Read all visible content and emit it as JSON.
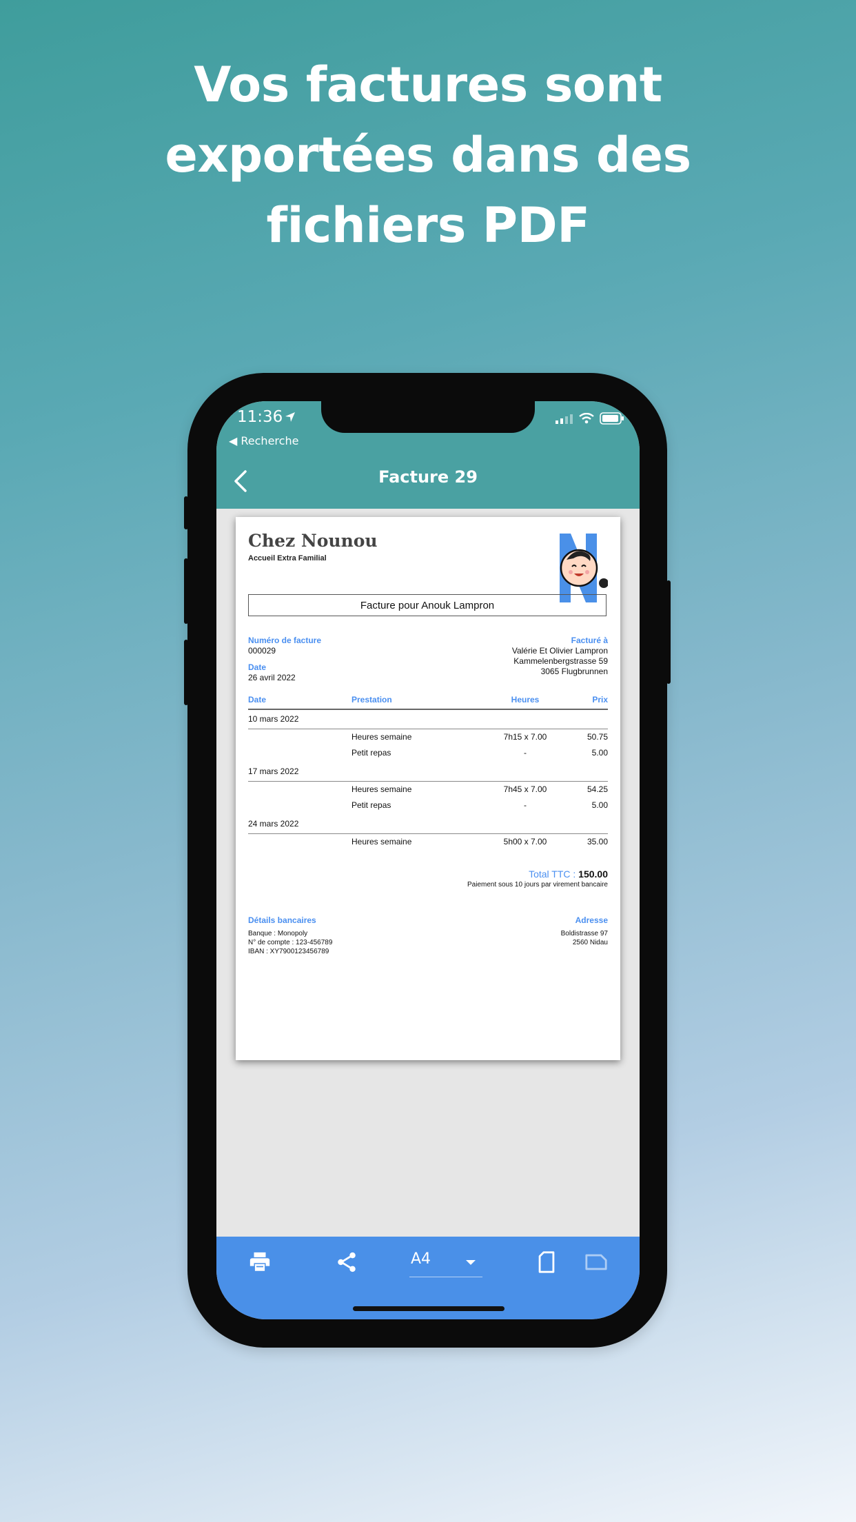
{
  "headline": [
    "Vos factures sont",
    "exportées dans des",
    "fichiers PDF"
  ],
  "status_bar": {
    "time": "11:36",
    "back_app": "◀ Recherche"
  },
  "nav": {
    "title": "Facture 29"
  },
  "invoice": {
    "brand": "Chez Nounou",
    "brand_sub": "Accueil Extra Familial",
    "invoice_for": "Facture pour Anouk Lampron",
    "number_label": "Numéro de facture",
    "number": "000029",
    "date_label": "Date",
    "date": "26 avril 2022",
    "billed_label": "Facturé à",
    "billed_lines": [
      "Valérie Et Olivier Lampron",
      "Kammelenbergstrasse 59",
      "3065 Flugbrunnen"
    ],
    "columns": [
      "Date",
      "Prestation",
      "Heures",
      "Prix"
    ],
    "groups": [
      {
        "date": "10 mars 2022",
        "rows": [
          {
            "service": "Heures semaine",
            "hours": "7h15 x 7.00",
            "price": "50.75"
          },
          {
            "service": "Petit repas",
            "hours": "-",
            "price": "5.00"
          }
        ]
      },
      {
        "date": "17 mars 2022",
        "rows": [
          {
            "service": "Heures semaine",
            "hours": "7h45 x 7.00",
            "price": "54.25"
          },
          {
            "service": "Petit repas",
            "hours": "-",
            "price": "5.00"
          }
        ]
      },
      {
        "date": "24 mars 2022",
        "rows": [
          {
            "service": "Heures semaine",
            "hours": "5h00 x 7.00",
            "price": "35.00"
          }
        ]
      }
    ],
    "total_label": "Total TTC :",
    "total_value": "150.00",
    "payment_note": "Paiement sous 10 jours par virement bancaire",
    "bank_label": "Détails bancaires",
    "bank_lines": [
      "Banque : Monopoly",
      "N° de compte : 123-456789",
      "IBAN : XY7900123456789"
    ],
    "address_label": "Adresse",
    "address_lines": [
      "Boldistrasse 97",
      "2560 Nidau"
    ]
  },
  "toolbar": {
    "paper_size": "A4"
  },
  "colors": {
    "teal": "#4aa1a2",
    "blue": "#4a90e8",
    "label_blue": "#4a8ff0"
  },
  "icons": [
    "location-arrow-icon",
    "signal-icon",
    "wifi-icon",
    "battery-icon",
    "back-chevron-icon",
    "printer-icon",
    "share-icon",
    "dropdown-caret-icon",
    "portrait-icon",
    "landscape-icon"
  ]
}
